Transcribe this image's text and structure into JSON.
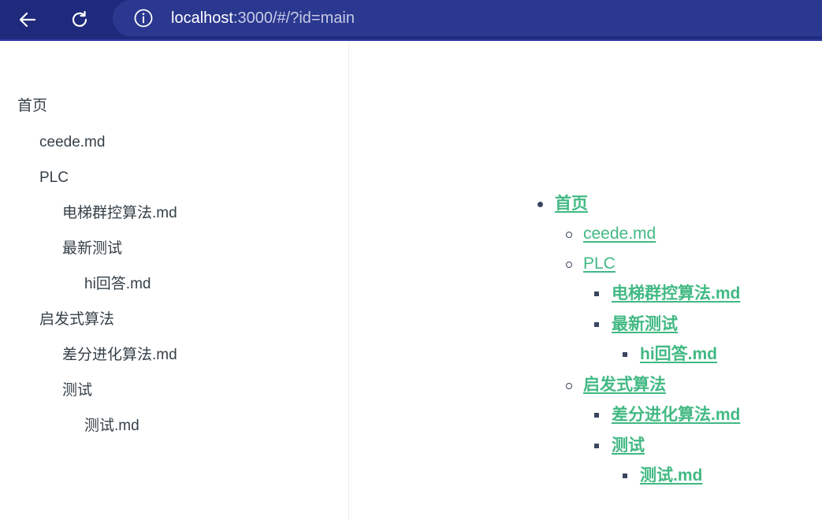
{
  "browser": {
    "url_host": "localhost",
    "url_rest": ":3000/#/?id=main",
    "icons": [
      "back-arrow-icon",
      "reload-icon",
      "info-icon"
    ],
    "colors": {
      "toolbar": "#1f2a7d",
      "omnibox": "#2b388f"
    }
  },
  "sidebar": {
    "items": [
      {
        "label": "首页"
      },
      {
        "label": "ceede.md"
      },
      {
        "label": "PLC"
      },
      {
        "label": "电梯群控算法.md"
      },
      {
        "label": "最新测试"
      },
      {
        "label": "hi回答.md"
      },
      {
        "label": "启发式算法"
      },
      {
        "label": "差分进化算法.md"
      },
      {
        "label": "测试"
      },
      {
        "label": "测试.md"
      }
    ]
  },
  "content": {
    "tree": [
      {
        "label": "首页"
      },
      {
        "label": "ceede.md"
      },
      {
        "label": "PLC"
      },
      {
        "label": "电梯群控算法.md"
      },
      {
        "label": "最新测试"
      },
      {
        "label": "hi回答.md"
      },
      {
        "label": "启发式算法"
      },
      {
        "label": "差分进化算法.md"
      },
      {
        "label": "测试"
      },
      {
        "label": "测试.md"
      }
    ],
    "link_color": "#42b983"
  }
}
